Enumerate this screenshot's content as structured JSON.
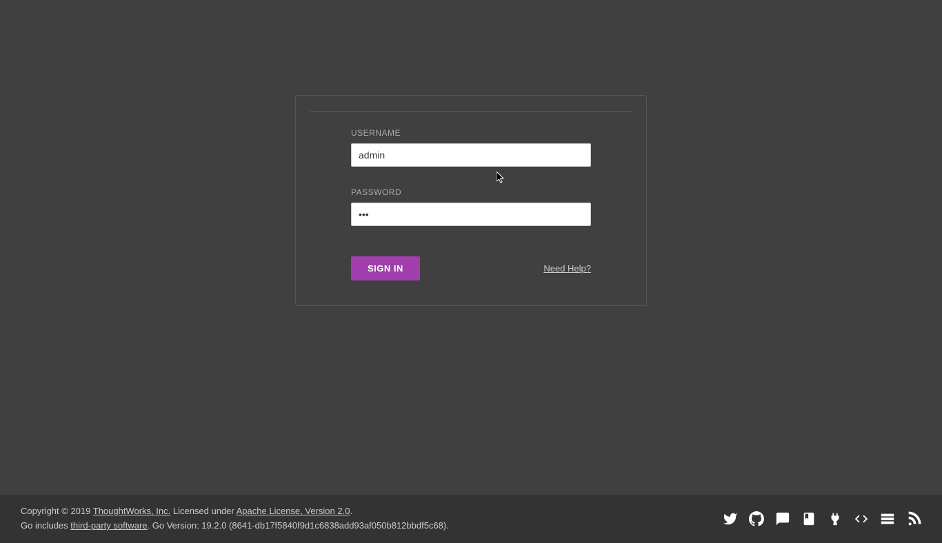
{
  "login": {
    "username_label": "USERNAME",
    "username_value": "admin",
    "password_label": "PASSWORD",
    "password_value": "•••",
    "signin_button": "SIGN IN",
    "help_link": "Need Help?"
  },
  "footer": {
    "copyright_prefix": "Copyright © 2019 ",
    "company_link": "ThoughtWorks, Inc.",
    "licensed_text": " Licensed under ",
    "license_link": "Apache License, Version 2.0",
    "license_suffix": ".",
    "go_includes_prefix": "Go includes ",
    "thirdparty_link": "third-party software",
    "version_text": ". Go Version: 19.2.0 (8641-db17f5840f9d1c6838add93af050b812bbdf5c68)."
  }
}
